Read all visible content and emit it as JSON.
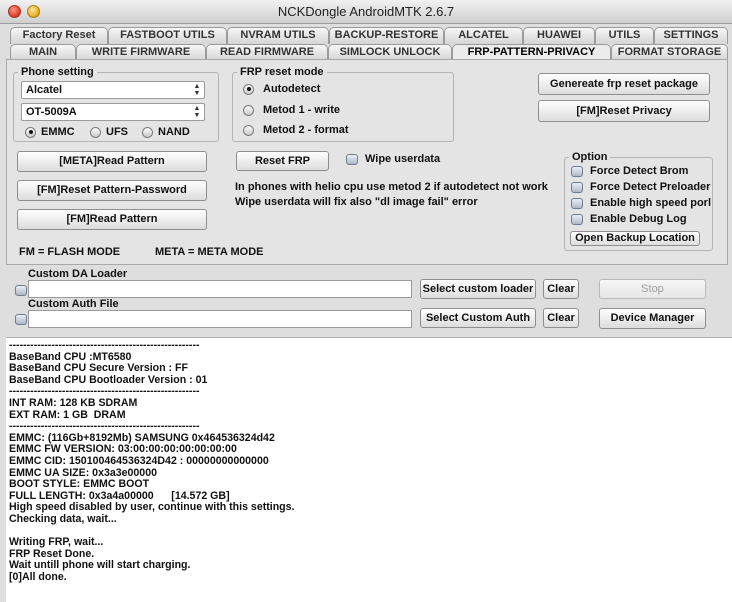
{
  "window": {
    "title": "NCKDongle AndroidMTK 2.6.7"
  },
  "tabs_row1": [
    "Factory Reset",
    "FASTBOOT UTILS",
    "NVRAM UTILS",
    "BACKUP-RESTORE",
    "ALCATEL",
    "HUAWEI",
    "UTILS",
    "SETTINGS"
  ],
  "tabs_row2": [
    "MAIN",
    "WRITE FIRMWARE",
    "READ FIRMWARE",
    "SIMLOCK UNLOCK",
    "FRP-PATTERN-PRIVACY",
    "FORMAT STORAGE"
  ],
  "active_tab": "FRP-PATTERN-PRIVACY",
  "phone_setting": {
    "legend": "Phone setting",
    "brand": "Alcatel",
    "model": "OT-5009A",
    "storage_options": [
      "EMMC",
      "UFS",
      "NAND"
    ],
    "storage_selected": "EMMC"
  },
  "buttons_left": [
    "[META]Read Pattern",
    "[FM]Reset Pattern-Password",
    "[FM]Read Pattern"
  ],
  "frp": {
    "legend": "FRP reset mode",
    "modes": [
      "Autodetect",
      "Metod 1 - write",
      "Metod 2 - format"
    ],
    "selected": "Autodetect",
    "reset_button": "Reset FRP",
    "wipe_label": "Wipe userdata",
    "note1": "In phones with helio cpu use metod 2 if autodetect not work",
    "note2": "Wipe userdata will fix also \"dl image fail\" error"
  },
  "right_buttons": [
    "Genereate frp reset package",
    "[FM]Reset Privacy"
  ],
  "options": {
    "legend": "Option",
    "items": [
      "Force Detect Brom",
      "Force Detect Preloader",
      "Enable high speed porl",
      "Enable Debug Log"
    ],
    "backup_button": "Open Backup Location"
  },
  "legend_text": {
    "fm": "FM = FLASH MODE",
    "meta": "META = META MODE"
  },
  "custom_da": {
    "label": "Custom DA Loader",
    "value": "",
    "select_button": "Select custom loader",
    "clear_button": "Clear"
  },
  "custom_auth": {
    "label": "Custom Auth File",
    "value": "",
    "select_button": "Select Custom Auth",
    "clear_button": "Clear"
  },
  "stop_button": "Stop",
  "device_manager_button": "Device Manager",
  "log": [
    "------------------------------------------------------",
    "BaseBand CPU :MT6580",
    "BaseBand CPU Secure Version : FF",
    "BaseBand CPU Bootloader Version : 01",
    "------------------------------------------------------",
    "INT RAM: 128 KB SDRAM",
    "EXT RAM: 1 GB  DRAM",
    "------------------------------------------------------",
    "EMMC: (116Gb+8192Mb) SAMSUNG 0x464536324d42",
    "EMMC FW VERSION: 03:00:00:00:00:00:00:00",
    "EMMC CID: 150100464536324D42 : 00000000000000",
    "EMMC UA SIZE: 0x3a3e00000",
    "BOOT STYLE: EMMC BOOT",
    "FULL LENGTH: 0x3a4a00000      [14.572 GB]",
    "High speed disabled by user, continue with this settings.",
    "Checking data, wait...",
    "",
    "Writing FRP, wait...",
    "FRP Reset Done.",
    "Wait untill phone will start charging.",
    "[0]All done."
  ]
}
